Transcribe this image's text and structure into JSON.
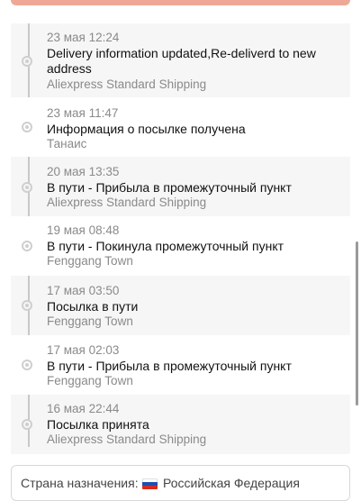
{
  "tracking": {
    "events": [
      {
        "time": "23 мая 12:24",
        "description": "Delivery information updated,Re-deliverd to new address",
        "location": "Aliexpress Standard Shipping"
      },
      {
        "time": "23 мая 11:47",
        "description": "Информация о посылке получена",
        "location": "Танаис"
      },
      {
        "time": "20 мая 13:35",
        "description": "В пути - Прибыла в промежуточный пункт",
        "location": "Aliexpress Standard Shipping"
      },
      {
        "time": "19 мая 08:48",
        "description": "В пути - Покинула промежуточный пункт",
        "location": "Fenggang Town"
      },
      {
        "time": "17 мая 03:50",
        "description": "Посылка в пути",
        "location": "Fenggang Town"
      },
      {
        "time": "17 мая 02:03",
        "description": "В пути - Прибыла в промежуточный пункт",
        "location": "Fenggang Town"
      },
      {
        "time": "16 мая 22:44",
        "description": "Посылка принята",
        "location": "Aliexpress Standard Shipping"
      }
    ]
  },
  "destination": {
    "label": "Страна назначения:",
    "flag_icon": "russia-flag-icon",
    "country": "Российская Федерация"
  },
  "colors": {
    "banner": "#efa895",
    "timeline_bg": "#f6f6f6",
    "muted_text": "#8a8a8a"
  }
}
